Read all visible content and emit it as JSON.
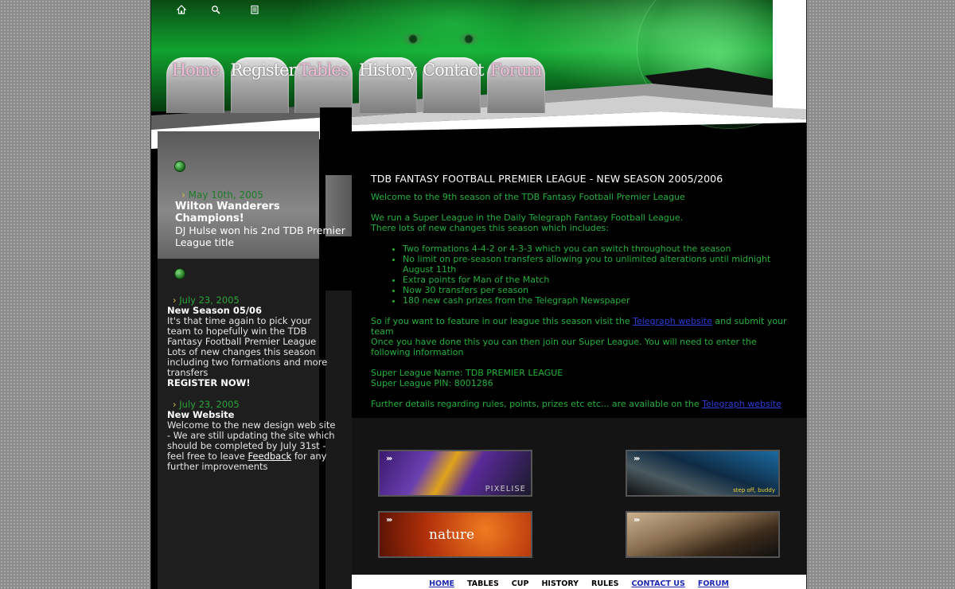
{
  "nav": {
    "tabs": [
      {
        "label": "Home",
        "pink": true
      },
      {
        "label": "Register",
        "pink": false
      },
      {
        "label": "Tables",
        "pink": true
      },
      {
        "label": "History",
        "pink": false
      },
      {
        "label": "Contact",
        "pink": false
      },
      {
        "label": "Forum",
        "pink": true
      }
    ]
  },
  "topbar": {
    "icons": [
      "home-icon",
      "search-icon",
      "document-icon"
    ]
  },
  "sidebar": {
    "feature": {
      "date": "May 10th, 2005",
      "headline": "Wilton Wanderers Champions!",
      "text": "DJ Hulse won his 2nd TDB Premier League title"
    },
    "news": [
      {
        "date": "July 23, 2005",
        "headline": "New Season 05/06",
        "text": "It's that time again to pick your team to hopefully win the TDB Fantasy Football Premier League",
        "text2": "Lots of new changes this season including two formations and more transfers",
        "cta": "REGISTER NOW!"
      },
      {
        "date": "July 23, 2005",
        "headline": "New Website",
        "text_before": "Welcome to the new design web site - We are still updating the site which should be completed by July 31st - feel free to leave ",
        "link": "Feedback",
        "text_after": " for any further improvements"
      }
    ]
  },
  "main": {
    "title": "TDB FANTASY FOOTBALL PREMIER LEAGUE - NEW SEASON 2005/2006",
    "welcome": "Welcome to the 9th season of the TDB Fantasy Football Premier League",
    "intro1": "We run a Super League in the Daily Telegraph Fantasy Football League.",
    "intro2": "There lots of new changes this season which includes:",
    "bullets": [
      "Two formations 4-4-2 or 4-3-3 which you can switch throughout the season",
      "No limit on pre-season transfers allowing you to unlimited alterations until midnight August 11th",
      "Extra points for Man of the Match",
      "Now 30 transfers per season",
      "180 new cash prizes from the Telegraph Newspaper"
    ],
    "feature_pre": "So if you want to feature in our league this season visit the ",
    "feature_link": "Telegraph website",
    "feature_post": " and submit your team",
    "join": "Once you have done this you can then join our Super League.  You will need to enter the following information",
    "league_name": "Super League Name: TDB PREMIER LEAGUE",
    "league_pin": "Super League PIN: 8001286",
    "further_pre": "Further details regarding rules, points, prizes etc etc... are  available on the ",
    "further_link": "Telegraph website"
  },
  "thumbs": [
    {
      "arrows": "›››",
      "caption": "PIXELISE"
    },
    {
      "arrows": "›››",
      "caption": "step off, buddy"
    },
    {
      "arrows": "›››",
      "caption": "nature"
    },
    {
      "arrows": "›››",
      "caption": ""
    }
  ],
  "footer": {
    "links": [
      {
        "label": "HOME",
        "link": true
      },
      {
        "label": "TABLES",
        "link": false
      },
      {
        "label": "CUP",
        "link": false
      },
      {
        "label": "HISTORY",
        "link": false
      },
      {
        "label": "RULES",
        "link": false
      },
      {
        "label": "CONTACT US",
        "link": true
      },
      {
        "label": "FORUM",
        "link": true
      }
    ]
  }
}
